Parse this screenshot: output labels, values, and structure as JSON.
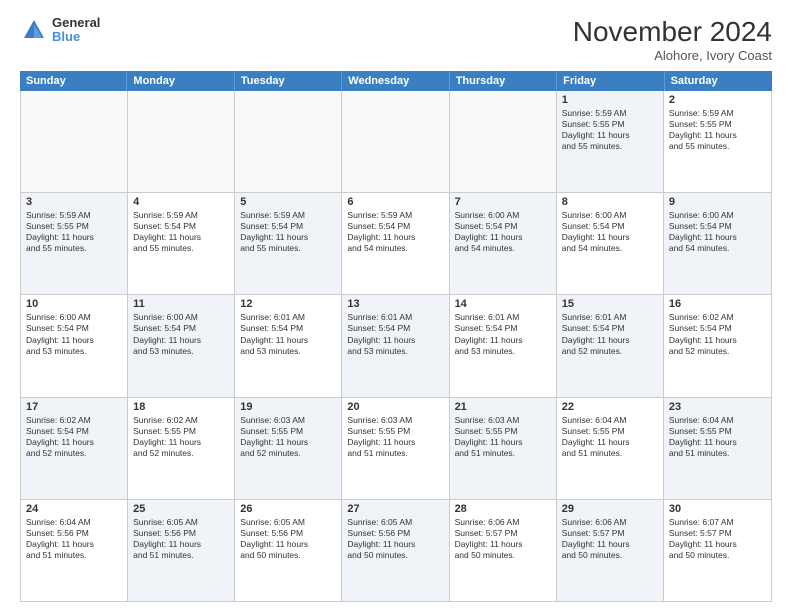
{
  "header": {
    "logo_line1": "General",
    "logo_line2": "Blue",
    "month_title": "November 2024",
    "location": "Alohore, Ivory Coast"
  },
  "calendar": {
    "days_of_week": [
      "Sunday",
      "Monday",
      "Tuesday",
      "Wednesday",
      "Thursday",
      "Friday",
      "Saturday"
    ],
    "weeks": [
      [
        {
          "day": "",
          "text": "",
          "empty": true
        },
        {
          "day": "",
          "text": "",
          "empty": true
        },
        {
          "day": "",
          "text": "",
          "empty": true
        },
        {
          "day": "",
          "text": "",
          "empty": true
        },
        {
          "day": "",
          "text": "",
          "empty": true
        },
        {
          "day": "1",
          "text": "Sunrise: 5:59 AM\nSunset: 5:55 PM\nDaylight: 11 hours\nand 55 minutes.",
          "shaded": true
        },
        {
          "day": "2",
          "text": "Sunrise: 5:59 AM\nSunset: 5:55 PM\nDaylight: 11 hours\nand 55 minutes.",
          "shaded": false
        }
      ],
      [
        {
          "day": "3",
          "text": "Sunrise: 5:59 AM\nSunset: 5:55 PM\nDaylight: 11 hours\nand 55 minutes.",
          "shaded": true
        },
        {
          "day": "4",
          "text": "Sunrise: 5:59 AM\nSunset: 5:54 PM\nDaylight: 11 hours\nand 55 minutes.",
          "shaded": false
        },
        {
          "day": "5",
          "text": "Sunrise: 5:59 AM\nSunset: 5:54 PM\nDaylight: 11 hours\nand 55 minutes.",
          "shaded": true
        },
        {
          "day": "6",
          "text": "Sunrise: 5:59 AM\nSunset: 5:54 PM\nDaylight: 11 hours\nand 54 minutes.",
          "shaded": false
        },
        {
          "day": "7",
          "text": "Sunrise: 6:00 AM\nSunset: 5:54 PM\nDaylight: 11 hours\nand 54 minutes.",
          "shaded": true
        },
        {
          "day": "8",
          "text": "Sunrise: 6:00 AM\nSunset: 5:54 PM\nDaylight: 11 hours\nand 54 minutes.",
          "shaded": false
        },
        {
          "day": "9",
          "text": "Sunrise: 6:00 AM\nSunset: 5:54 PM\nDaylight: 11 hours\nand 54 minutes.",
          "shaded": true
        }
      ],
      [
        {
          "day": "10",
          "text": "Sunrise: 6:00 AM\nSunset: 5:54 PM\nDaylight: 11 hours\nand 53 minutes.",
          "shaded": false
        },
        {
          "day": "11",
          "text": "Sunrise: 6:00 AM\nSunset: 5:54 PM\nDaylight: 11 hours\nand 53 minutes.",
          "shaded": true
        },
        {
          "day": "12",
          "text": "Sunrise: 6:01 AM\nSunset: 5:54 PM\nDaylight: 11 hours\nand 53 minutes.",
          "shaded": false
        },
        {
          "day": "13",
          "text": "Sunrise: 6:01 AM\nSunset: 5:54 PM\nDaylight: 11 hours\nand 53 minutes.",
          "shaded": true
        },
        {
          "day": "14",
          "text": "Sunrise: 6:01 AM\nSunset: 5:54 PM\nDaylight: 11 hours\nand 53 minutes.",
          "shaded": false
        },
        {
          "day": "15",
          "text": "Sunrise: 6:01 AM\nSunset: 5:54 PM\nDaylight: 11 hours\nand 52 minutes.",
          "shaded": true
        },
        {
          "day": "16",
          "text": "Sunrise: 6:02 AM\nSunset: 5:54 PM\nDaylight: 11 hours\nand 52 minutes.",
          "shaded": false
        }
      ],
      [
        {
          "day": "17",
          "text": "Sunrise: 6:02 AM\nSunset: 5:54 PM\nDaylight: 11 hours\nand 52 minutes.",
          "shaded": true
        },
        {
          "day": "18",
          "text": "Sunrise: 6:02 AM\nSunset: 5:55 PM\nDaylight: 11 hours\nand 52 minutes.",
          "shaded": false
        },
        {
          "day": "19",
          "text": "Sunrise: 6:03 AM\nSunset: 5:55 PM\nDaylight: 11 hours\nand 52 minutes.",
          "shaded": true
        },
        {
          "day": "20",
          "text": "Sunrise: 6:03 AM\nSunset: 5:55 PM\nDaylight: 11 hours\nand 51 minutes.",
          "shaded": false
        },
        {
          "day": "21",
          "text": "Sunrise: 6:03 AM\nSunset: 5:55 PM\nDaylight: 11 hours\nand 51 minutes.",
          "shaded": true
        },
        {
          "day": "22",
          "text": "Sunrise: 6:04 AM\nSunset: 5:55 PM\nDaylight: 11 hours\nand 51 minutes.",
          "shaded": false
        },
        {
          "day": "23",
          "text": "Sunrise: 6:04 AM\nSunset: 5:55 PM\nDaylight: 11 hours\nand 51 minutes.",
          "shaded": true
        }
      ],
      [
        {
          "day": "24",
          "text": "Sunrise: 6:04 AM\nSunset: 5:56 PM\nDaylight: 11 hours\nand 51 minutes.",
          "shaded": false
        },
        {
          "day": "25",
          "text": "Sunrise: 6:05 AM\nSunset: 5:56 PM\nDaylight: 11 hours\nand 51 minutes.",
          "shaded": true
        },
        {
          "day": "26",
          "text": "Sunrise: 6:05 AM\nSunset: 5:56 PM\nDaylight: 11 hours\nand 50 minutes.",
          "shaded": false
        },
        {
          "day": "27",
          "text": "Sunrise: 6:05 AM\nSunset: 5:56 PM\nDaylight: 11 hours\nand 50 minutes.",
          "shaded": true
        },
        {
          "day": "28",
          "text": "Sunrise: 6:06 AM\nSunset: 5:57 PM\nDaylight: 11 hours\nand 50 minutes.",
          "shaded": false
        },
        {
          "day": "29",
          "text": "Sunrise: 6:06 AM\nSunset: 5:57 PM\nDaylight: 11 hours\nand 50 minutes.",
          "shaded": true
        },
        {
          "day": "30",
          "text": "Sunrise: 6:07 AM\nSunset: 5:57 PM\nDaylight: 11 hours\nand 50 minutes.",
          "shaded": false
        }
      ]
    ]
  }
}
